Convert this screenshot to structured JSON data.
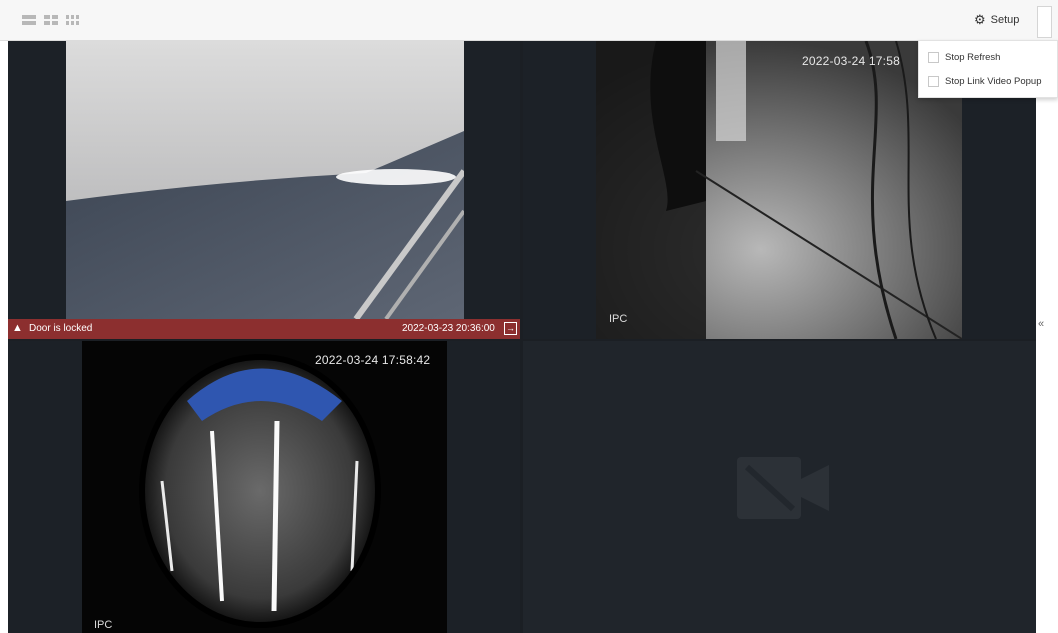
{
  "toolbar": {
    "layouts": [
      "layout-1x1-icon",
      "layout-2x2-icon",
      "layout-3x3-icon"
    ],
    "setup_label": "Setup"
  },
  "dropdown": {
    "items": [
      {
        "label": "Stop Refresh",
        "checked": false
      },
      {
        "label": "Stop Link Video Popup",
        "checked": false
      }
    ]
  },
  "tiles": [
    {
      "alarm": {
        "message": "Door is locked",
        "time": "2022-03-23 20:36:00"
      }
    },
    {
      "timestamp": "2022-03-24 17:58",
      "label": "IPC"
    },
    {
      "timestamp": "2022-03-24 17:58:42",
      "label": "IPC"
    },
    {
      "empty": true
    }
  ],
  "side_handle": "«",
  "colors": {
    "alarm_bar": "#8c2f2f",
    "grid_bg": "#1b1f24"
  }
}
